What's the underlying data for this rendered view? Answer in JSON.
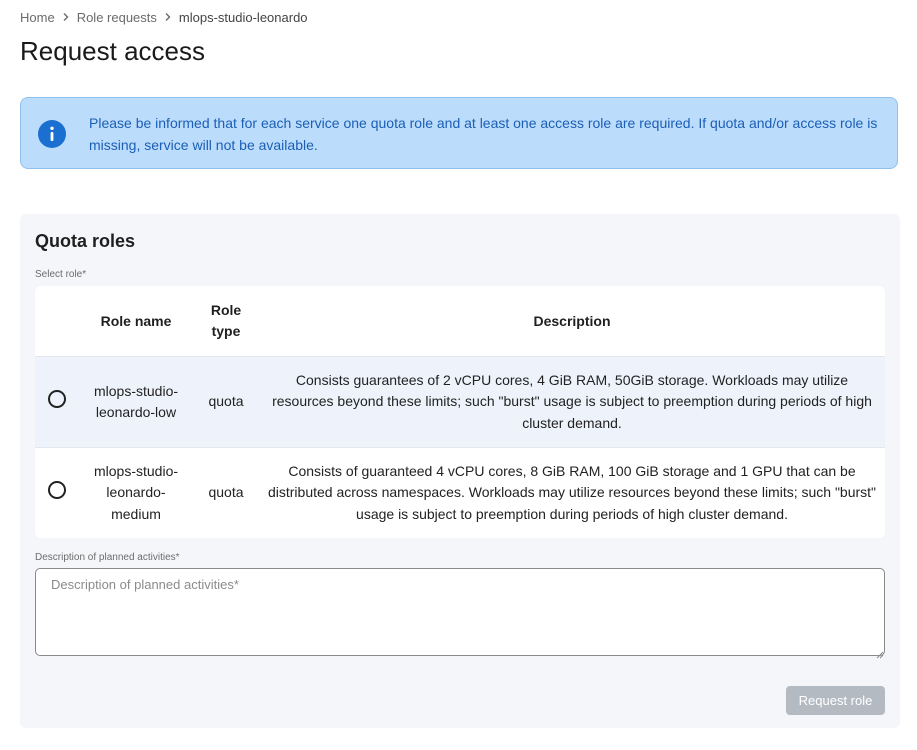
{
  "breadcrumb": {
    "items": [
      "Home",
      "Role requests",
      "mlops-studio-leonardo"
    ]
  },
  "page": {
    "title": "Request access"
  },
  "info_banner": {
    "text": "Please be informed that for each service one quota role and at least one access role are required. If quota and/or access role is missing, service will not be available.",
    "icon": "info-icon",
    "accent": "#1b5fb6",
    "background": "#bcdcfb"
  },
  "quota_roles": {
    "title": "Quota roles",
    "select_label": "Select role*",
    "columns": [
      "",
      "Role name",
      "Role type",
      "Description"
    ],
    "rows": [
      {
        "selected": false,
        "role_name": "mlops-studio-leonardo-low",
        "role_type": "quota",
        "description": "Consists guarantees of 2 vCPU cores, 4 GiB RAM, 50GiB storage. Workloads may utilize resources beyond these limits; such \"burst\" usage is subject to preemption during periods of high cluster demand."
      },
      {
        "selected": false,
        "role_name": "mlops-studio-leonardo-medium",
        "role_type": "quota",
        "description": "Consists of guaranteed 4 vCPU cores, 8 GiB RAM, 100 GiB storage and 1 GPU that can be distributed across namespaces. Workloads may utilize resources beyond these limits; such \"burst\" usage is subject to preemption during periods of high cluster demand."
      }
    ],
    "activities_label": "Description of planned activities*",
    "activities_placeholder": "Description of planned activities*",
    "activities_value": "",
    "request_button": "Request role"
  }
}
